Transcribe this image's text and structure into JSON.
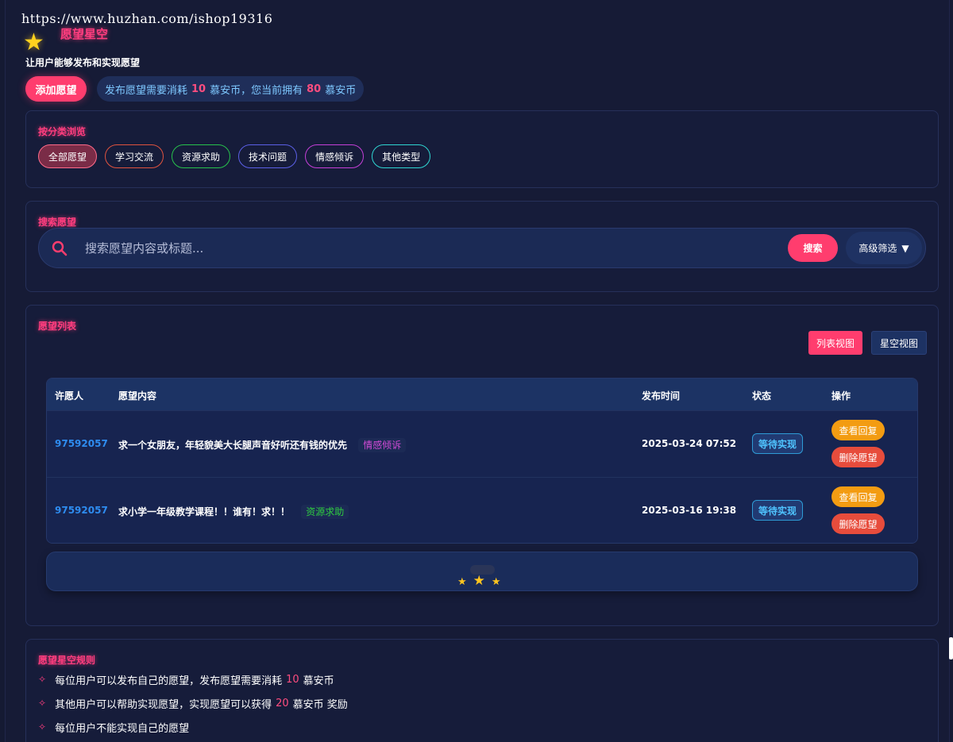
{
  "watermark": "https://www.huzhan.com/ishop19316",
  "header": {
    "title": "愿望星空",
    "subtitle": "让用户能够发布和实现愿望",
    "add_button": "添加愿望",
    "cost_prefix": "发布愿望需要消耗",
    "cost_value": "10",
    "cost_unit": "慕安币",
    "own_prefix": "，您当前拥有",
    "own_value": "80",
    "own_unit": "慕安币"
  },
  "categories": {
    "title": "按分类浏览",
    "items": [
      {
        "label": "全部愿望",
        "color": "#ff6b8a",
        "active": true
      },
      {
        "label": "学习交流",
        "color": "#e0533f"
      },
      {
        "label": "资源求助",
        "color": "#27c24c"
      },
      {
        "label": "技术问题",
        "color": "#5b5fe6"
      },
      {
        "label": "情感倾诉",
        "color": "#c53fd8"
      },
      {
        "label": "其他类型",
        "color": "#2fd6d2"
      }
    ]
  },
  "search": {
    "title": "搜索愿望",
    "placeholder": "搜索愿望内容或标题...",
    "button": "搜索",
    "advanced": "高级筛选",
    "advanced_caret": "▼"
  },
  "wish_list": {
    "title": "愿望列表",
    "view_list": "列表视图",
    "view_star": "星空视图",
    "columns": [
      "许愿人",
      "愿望内容",
      "发布时间",
      "状态",
      "操作"
    ],
    "rows": [
      {
        "user": "97592057",
        "content": "求一个女朋友，年轻貌美大长腿声音好听还有钱的优先",
        "category": "情感倾诉",
        "category_color": "#d24bd6",
        "time": "2025-03-24 07:52",
        "status": "等待实现",
        "action_view": "查看回复",
        "action_delete": "删除愿望"
      },
      {
        "user": "97592057",
        "content": "求小学一年级教学课程！！谁有！求！！",
        "category": "资源求助",
        "category_color": "#2ecc40",
        "time": "2025-03-16 19:38",
        "status": "等待实现",
        "action_view": "查看回复",
        "action_delete": "删除愿望"
      }
    ]
  },
  "rules": {
    "title": "愿望星空规则",
    "r1_pre": "每位用户可以发布自己的愿望，发布愿望需要消耗",
    "r1_num": "10",
    "r1_post": "慕安币",
    "r2_pre": "其他用户可以帮助实现愿望，实现愿望可以获得",
    "r2_num": "20",
    "r2_post": "慕安币 奖励",
    "r3": "每位用户不能实现自己的愿望"
  },
  "icons": {
    "logo": "star-icon",
    "search": "search-icon",
    "bullet": "sparkle-bullet-icon"
  },
  "colors": {
    "accent": "#ff3d6e",
    "background": "#161b36"
  }
}
